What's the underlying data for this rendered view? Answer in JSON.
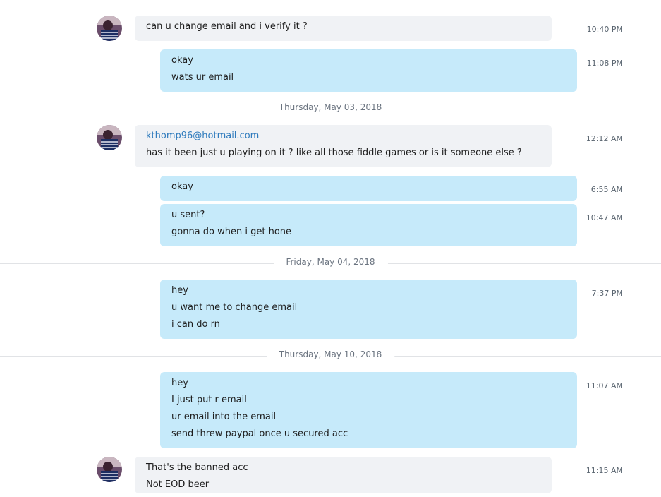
{
  "messages": {
    "m1": {
      "lines": [
        "can u change email and i verify it ?"
      ],
      "time": "10:40 PM"
    },
    "m2": {
      "lines": [
        "okay",
        "wats ur email"
      ],
      "time": "11:08 PM"
    },
    "d1": "Thursday, May 03, 2018",
    "m3": {
      "link": "kthomp96@hotmail.com",
      "lines": [
        "has it been just u playing on it ? like all those fiddle games or is it someone else ?"
      ],
      "time": "12:12 AM"
    },
    "m4": {
      "lines": [
        "okay"
      ],
      "time": "6:55 AM"
    },
    "m5": {
      "lines": [
        "u sent?",
        "gonna do when i get hone"
      ],
      "time": "10:47 AM"
    },
    "d2": "Friday, May 04, 2018",
    "m6": {
      "lines": [
        "hey",
        "u want me to change email",
        "i can do rn"
      ],
      "time": "7:37 PM"
    },
    "d3": "Thursday, May 10, 2018",
    "m7": {
      "lines": [
        "hey",
        "I just put r email",
        "ur email into the  email",
        "send threw paypal once u secured acc"
      ],
      "time": "11:07 AM"
    },
    "m8": {
      "lines": [
        "That's the banned acc",
        "Not EOD beer"
      ],
      "time": "11:15 AM"
    }
  },
  "colors": {
    "incoming": "#f0f2f5",
    "outgoing": "#c6eafa",
    "link": "#2f7bbd"
  },
  "icons": {
    "avatar": "contact-avatar"
  }
}
